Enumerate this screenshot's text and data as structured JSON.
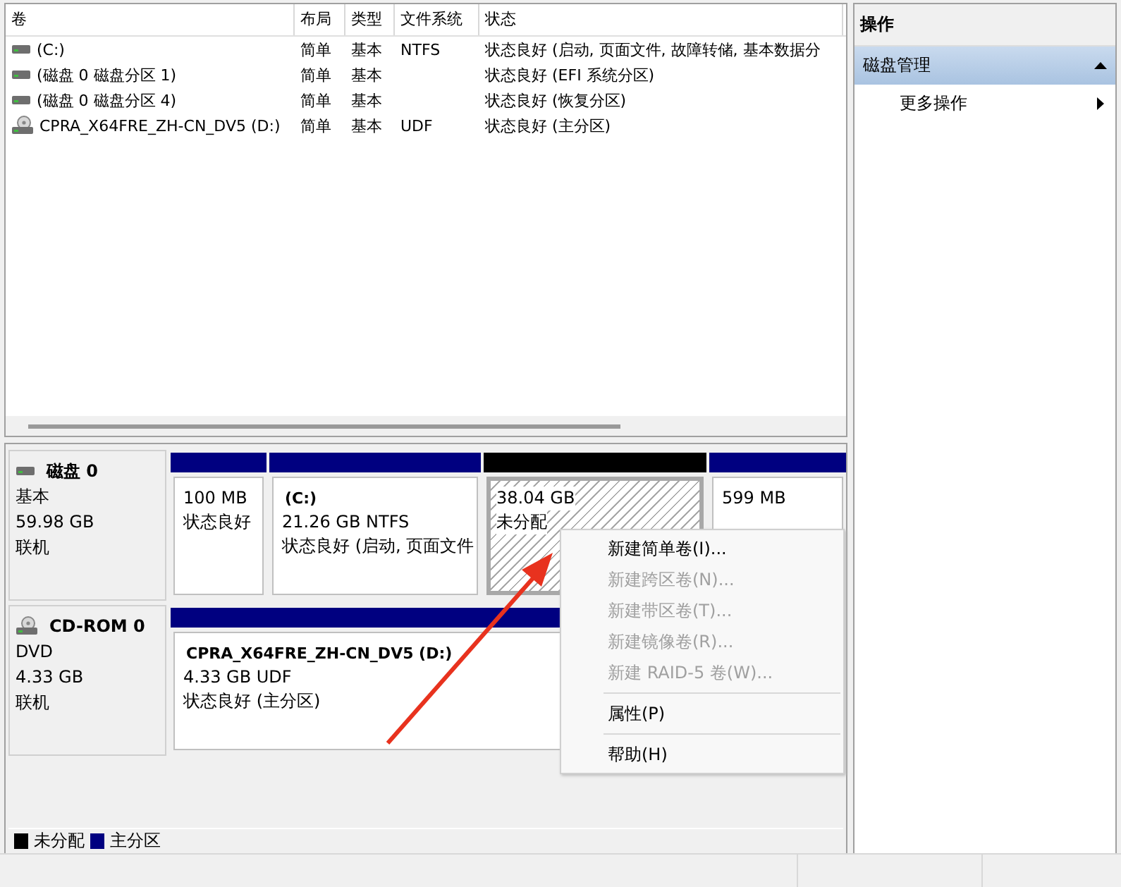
{
  "volume_list": {
    "columns": [
      "卷",
      "布局",
      "类型",
      "文件系统",
      "状态"
    ],
    "rows": [
      {
        "kind": "drive",
        "cells": [
          "(C:)",
          "简单",
          "基本",
          "NTFS",
          "状态良好 (启动, 页面文件, 故障转储, 基本数据分"
        ]
      },
      {
        "kind": "drive",
        "cells": [
          "(磁盘 0 磁盘分区 1)",
          "简单",
          "基本",
          "",
          "状态良好 (EFI 系统分区)"
        ]
      },
      {
        "kind": "drive",
        "cells": [
          "(磁盘 0 磁盘分区 4)",
          "简单",
          "基本",
          "",
          "状态良好 (恢复分区)"
        ]
      },
      {
        "kind": "cd",
        "cells": [
          "CPRA_X64FRE_ZH-CN_DV5 (D:)",
          "简单",
          "基本",
          "UDF",
          "状态良好 (主分区)"
        ]
      }
    ]
  },
  "disks": [
    {
      "kind": "drive",
      "name": "磁盘 0",
      "lines": [
        "基本",
        "59.98 GB",
        "联机"
      ],
      "partitions": [
        {
          "kind": "primary",
          "color": "#000080",
          "selected": false,
          "lines": [
            "100 MB",
            "状态良好"
          ]
        },
        {
          "kind": "primary",
          "color": "#000080",
          "selected": false,
          "title": "(C:)",
          "lines": [
            "21.26 GB NTFS",
            "状态良好 (启动, 页面文件"
          ]
        },
        {
          "kind": "unallocated",
          "color": "#000000",
          "selected": true,
          "lines": [
            "38.04 GB",
            "未分配"
          ]
        },
        {
          "kind": "primary",
          "color": "#000080",
          "selected": false,
          "lines": [
            "599 MB"
          ]
        }
      ]
    },
    {
      "kind": "cd",
      "name": "CD-ROM 0",
      "lines": [
        "DVD",
        "4.33 GB",
        "联机"
      ],
      "partitions": [
        {
          "kind": "primary",
          "color": "#000080",
          "selected": false,
          "title": "CPRA_X64FRE_ZH-CN_DV5  (D:)",
          "lines": [
            "4.33 GB UDF",
            "状态良好 (主分区)"
          ]
        }
      ]
    }
  ],
  "legend": [
    {
      "label": "未分配",
      "color": "#000000"
    },
    {
      "label": "主分区",
      "color": "#000080"
    }
  ],
  "actions": {
    "title": "操作",
    "section": {
      "label": "磁盘管理",
      "expanded": true
    },
    "items": [
      {
        "label": "更多操作"
      }
    ]
  },
  "context_menu": [
    {
      "kind": "item",
      "label": "新建简单卷(I)...",
      "disabled": false
    },
    {
      "kind": "item",
      "label": "新建跨区卷(N)...",
      "disabled": true
    },
    {
      "kind": "item",
      "label": "新建带区卷(T)...",
      "disabled": true
    },
    {
      "kind": "item",
      "label": "新建镜像卷(R)...",
      "disabled": true
    },
    {
      "kind": "item",
      "label": "新建 RAID-5 卷(W)...",
      "disabled": true
    },
    {
      "kind": "separator"
    },
    {
      "kind": "item",
      "label": "属性(P)",
      "disabled": false
    },
    {
      "kind": "separator"
    },
    {
      "kind": "item",
      "label": "帮助(H)",
      "disabled": false
    }
  ]
}
